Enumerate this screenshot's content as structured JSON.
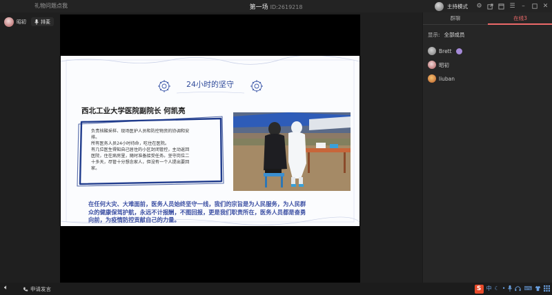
{
  "titlebar": {
    "left_link": "礼物问题点我",
    "session_title": "第一场",
    "session_id": "ID:2619218",
    "host_mode": "主持模式",
    "icons": [
      "gear-icon",
      "share-icon",
      "window-icon",
      "menu-icon",
      "minimize-icon",
      "maximize-icon",
      "close-icon"
    ]
  },
  "stage": {
    "user_name": "昭初",
    "mic_label": "排麦"
  },
  "slide": {
    "title": "24小时的坚守",
    "author": "西北工业大学医院副院长  何凯亮",
    "box_lines": [
      "负责核酸采样、现场医护人员和防控物资的协调和安",
      "排。",
      "所有医务人员24小时待命，吃住在医院。",
      "有几位医生得知自己居住的小区封闭管控，主动返回",
      "医院，住在病房里，随时准备接受任务。坚守岗位二",
      "十多天，尽管十分想念家人，但没有一个人提出要回",
      "家。"
    ],
    "bottom_lines": [
      "在任何大灾、大难面前，医务人员始终坚守一线，我们的宗旨是为人民服务，为人民群",
      "众的健康保驾护航，永远不计报酬，不图回报，更是我们职责所在，医务人员都是奋勇",
      "向前，为疫情防控贡献自己的力量。"
    ],
    "title_color": "#2f4a9a",
    "text_color": "#3b4fa3"
  },
  "panel": {
    "tabs": [
      {
        "label": "群聊",
        "active": false
      },
      {
        "label": "在线3",
        "active": true
      }
    ],
    "show_label": "显示:",
    "show_value": "全部成员",
    "members": [
      {
        "name": "Brett",
        "avatar_color": "#9a9a9a",
        "badge": true
      },
      {
        "name": "昭初",
        "avatar_color": "#c87a7a",
        "badge": false
      },
      {
        "name": "liuban",
        "avatar_color": "#d88a3a",
        "badge": false
      }
    ]
  },
  "bottombar": {
    "volume_icon": "speaker-icon",
    "apply_label": "申请发言",
    "ime_label": "S",
    "ime_lang": "中",
    "tray_icons": [
      "moon-icon",
      "dot-icon",
      "mic-icon",
      "headset-icon",
      "keyboard-icon",
      "shirt-icon",
      "grid-icon"
    ]
  }
}
